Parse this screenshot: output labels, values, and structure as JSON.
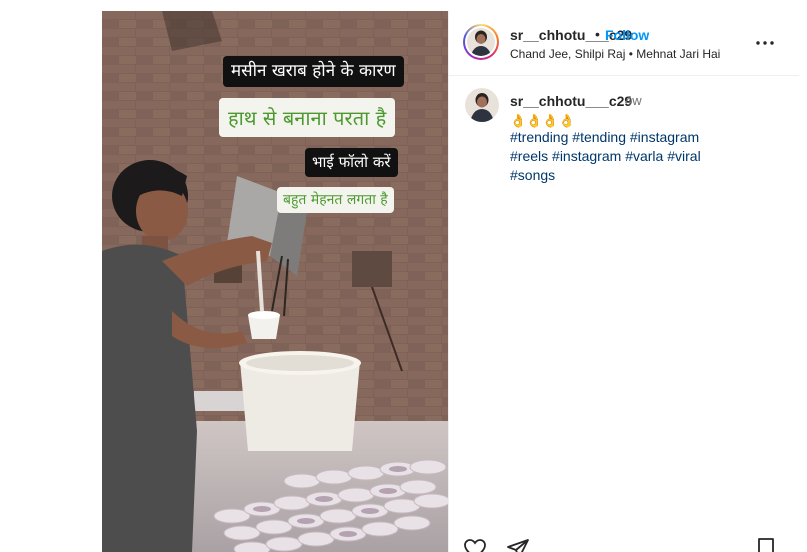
{
  "post": {
    "author": {
      "username": "sr__chhotu___c29",
      "follow_label": "Follow",
      "separator": "•"
    },
    "audio": {
      "artists": "Chand Jee, Shilpi Raj",
      "separator": "•",
      "title": "Mehnat Jari Hai"
    },
    "caption": {
      "username": "sr__chhotu___c29",
      "age": "4w",
      "emoji": "👌👌👌👌",
      "hashtags": [
        "#trending",
        "#tending",
        "#instagram",
        "#reels",
        "#instagram",
        "#varla",
        "#viral",
        "#songs"
      ]
    },
    "media_captions": [
      "मसीन खराब होने के कारण",
      "हाथ से बनाना परता है",
      "भाई फॉलो करें",
      "बहुत मेहनत लगता है"
    ]
  },
  "icons": {
    "more": "more-horizontal-icon",
    "like": "heart-icon",
    "share": "send-icon",
    "save": "bookmark-icon"
  },
  "colors": {
    "follow": "#0095f6",
    "hashtag": "#00376b",
    "caption_green": "#4c9a2f",
    "caption_black_bg": "#111111"
  }
}
